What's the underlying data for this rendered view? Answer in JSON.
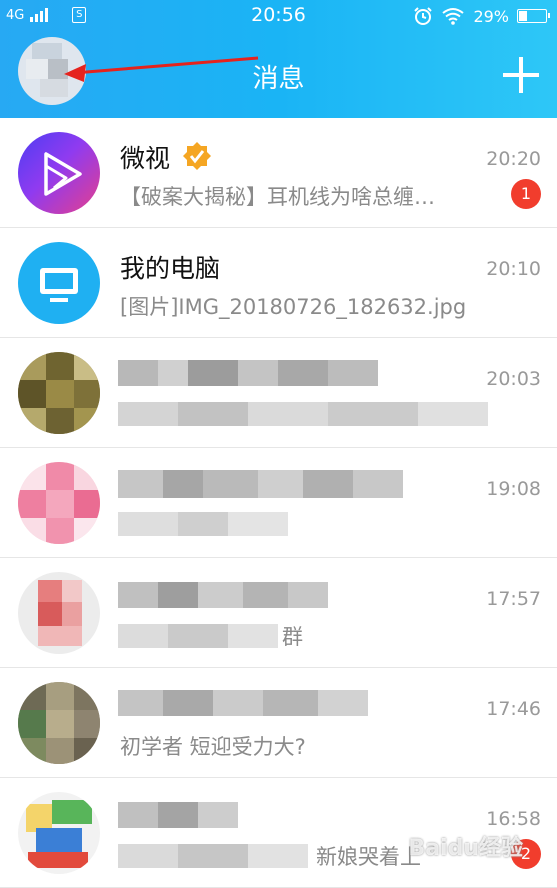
{
  "status_bar": {
    "network": "4G",
    "time": "20:56",
    "battery": "29%",
    "battery_level": 0.29,
    "sim_label": "S"
  },
  "header": {
    "title": "消息",
    "add_icon": "plus-icon",
    "colors": {
      "gradient_start": "#27a9f3",
      "gradient_end": "#2ec7f7"
    }
  },
  "conversations": [
    {
      "name": "微视",
      "verified": true,
      "preview": "【破案大揭秘】耳机线为啥总缠…",
      "time": "20:20",
      "badge": "1",
      "avatar_icon": "weishi-logo-icon"
    },
    {
      "name": "我的电脑",
      "preview": "[图片]IMG_20180726_182632.jpg",
      "time": "20:10",
      "avatar_icon": "monitor-icon"
    },
    {
      "name": "",
      "preview": "",
      "time": "20:03",
      "obscured": true
    },
    {
      "name": "",
      "preview": "",
      "time": "19:08",
      "obscured": true
    },
    {
      "name": "",
      "preview": "群",
      "time": "17:57",
      "obscured": true
    },
    {
      "name": "",
      "preview": "初学者 短迎受力大?",
      "time": "17:46",
      "obscured": true
    },
    {
      "name": "",
      "preview": "新娘哭着上",
      "time": "16:58",
      "badge": "2",
      "obscured": true
    }
  ],
  "watermark": "Baidu经验"
}
